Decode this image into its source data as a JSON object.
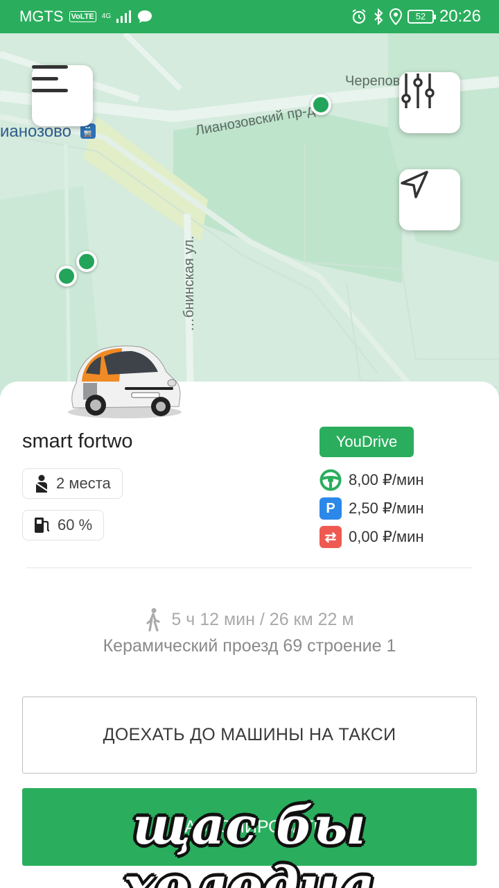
{
  "status_bar": {
    "carrier": "MGTS",
    "volte": "VoLTE",
    "network": "4G",
    "battery": "52",
    "time": "20:26"
  },
  "map": {
    "labels": {
      "lianozovsky": "Лианозовский пр-д",
      "station": "ианозово",
      "cherepovetskaya": "Черепов… ул.",
      "street": "…бнинская ул."
    }
  },
  "car": {
    "name": "smart fortwo",
    "seats": "2 места",
    "fuel": "60 %",
    "provider": "YouDrive",
    "prices": {
      "drive": "8,00 ₽/мин",
      "parking": "2,50 ₽/мин",
      "transfer": "0,00 ₽/мин"
    }
  },
  "route": {
    "walk": "5 ч 12 мин / 26 км 22 м",
    "address": "Керамический проезд 69 строение 1"
  },
  "actions": {
    "taxi": "ДОЕХАТЬ ДО МАШИНЫ НА ТАКСИ",
    "book": "ЗАБРОНИРОВАТЬ"
  },
  "overlay_caption": "щас бы холодца",
  "colors": {
    "accent": "#2aae5d",
    "parking": "#2b88e8",
    "transfer": "#ee5a52"
  }
}
